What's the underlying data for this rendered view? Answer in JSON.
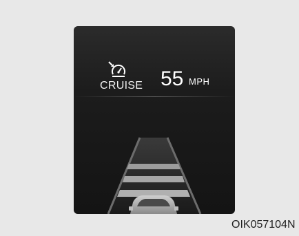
{
  "display": {
    "mode_label": "CRUISE",
    "mode_icon": "cruise-speedometer-icon",
    "speed_value": "55",
    "speed_unit": "MPH"
  },
  "image_code": "OIK057104N",
  "colors": {
    "panel_bg": "#1c1c1c",
    "text": "#ffffff",
    "lane_markings": "#9c9c9c"
  }
}
